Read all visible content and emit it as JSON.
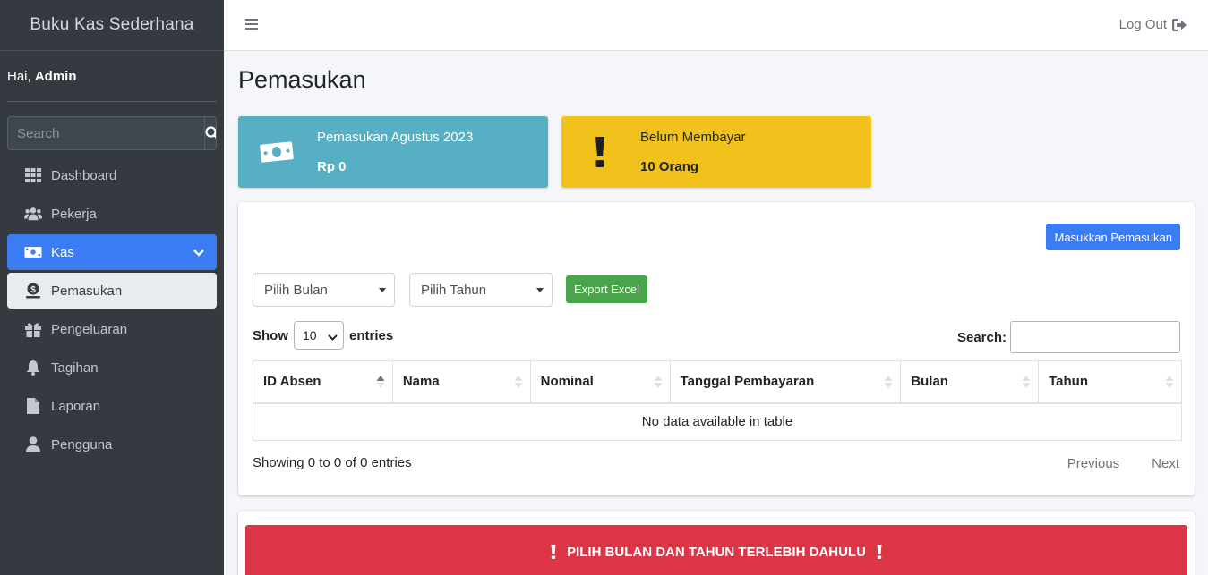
{
  "app": {
    "brand": "Buku Kas Sederhana"
  },
  "user": {
    "greeting": "Hai, ",
    "name": "Admin"
  },
  "sidebar": {
    "search_placeholder": "Search",
    "items": [
      {
        "label": "Dashboard",
        "icon": "grid-icon"
      },
      {
        "label": "Pekerja",
        "icon": "users-icon"
      },
      {
        "label": "Kas",
        "icon": "money-icon",
        "state": "active"
      },
      {
        "label": "Pemasukan",
        "icon": "dollar-hand-icon",
        "state": "sub-active"
      },
      {
        "label": "Pengeluaran",
        "icon": "gift-icon"
      },
      {
        "label": "Tagihan",
        "icon": "bell-icon"
      },
      {
        "label": "Laporan",
        "icon": "file-icon"
      },
      {
        "label": "Pengguna",
        "icon": "user-icon"
      }
    ]
  },
  "topbar": {
    "logout_label": "Log Out"
  },
  "page": {
    "title": "Pemasukan"
  },
  "info_boxes": [
    {
      "label": "Pemasukan Agustus 2023",
      "value": "Rp 0",
      "color": "#56afc2"
    },
    {
      "label": "Belum Membayar",
      "value": "10 Orang",
      "color": "#f1c21b"
    }
  ],
  "actions": {
    "add_income": "Masukkan Pemasukan",
    "month_select": "Pilih Bulan",
    "year_select": "Pilih Tahun",
    "export": "Export Excel"
  },
  "datatable": {
    "show_label": "Show",
    "entries_value": "10",
    "entries_label": "entries",
    "search_label": "Search:",
    "columns": [
      "ID Absen",
      "Nama",
      "Nominal",
      "Tanggal Pembayaran",
      "Bulan",
      "Tahun"
    ],
    "empty_message": "No data available in table",
    "info": "Showing 0 to 0 of 0 entries",
    "prev": "Previous",
    "next": "Next"
  },
  "alert": {
    "message": "PILIH BULAN DAN TAHUN TERLEBIH DAHULU",
    "color": "#dc3545"
  }
}
